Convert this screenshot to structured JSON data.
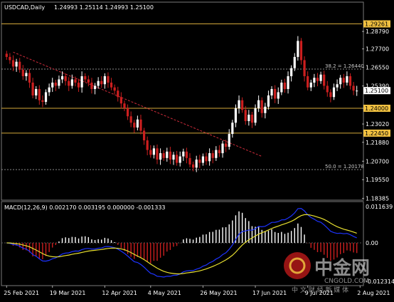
{
  "header": {
    "symbol": "USDCAD,Daily",
    "ohlc": "1.24993 1.25114 1.24993 1.25100"
  },
  "macd_label": "MACD(12,26,9) 0.002170 0.003195 0.000000 -0.001333",
  "levels": {
    "fib_382_label": "38.2 = 1.26440",
    "fib_50_label": "50.0 = 1.20178",
    "price_badges": [
      "1.29261",
      "1.25100",
      "1.24000",
      "1.22450"
    ]
  },
  "watermark": {
    "brand": "中金网",
    "url": "CNGOLD.COM",
    "tagline": "中 文 财 经 新 媒 体"
  },
  "colors": {
    "background": "#000000",
    "grid": "#4a4a4a",
    "bull_candle": "#ffffff",
    "bear_candle": "#cc1f1f",
    "hline": "#d4a83a",
    "trendline": "#cc2b3a",
    "macd_line": "#1d33ff",
    "signal_line": "#e8e030",
    "hist_pos": "#ffffff",
    "hist_neg": "#cc1f1f"
  },
  "chart_data": {
    "type": "candlestick",
    "symbol": "USDCAD",
    "timeframe": "Daily",
    "price_axis": {
      "ylim": [
        1.1885,
        1.2995
      ],
      "ticks": [
        "1.28790",
        "1.27700",
        "1.26550",
        "1.25390",
        "1.24000",
        "1.23020",
        "1.21880",
        "1.20700",
        "1.19550",
        "1.18385"
      ]
    },
    "x_ticks": [
      "25 Feb 2021",
      "19 Mar 2021",
      "12 Apr 2021",
      "4 May 2021",
      "26 May 2021",
      "17 Jun 2021",
      "9 Jul 2021",
      "2 Aug 2021"
    ],
    "x_tick_index": [
      0,
      14,
      30,
      44,
      60,
      76,
      92,
      108
    ],
    "horizontal_lines": [
      1.29261,
      1.24,
      1.2245
    ],
    "fib_levels": [
      {
        "label": "38.2",
        "value": 1.2644
      },
      {
        "label": "50.0",
        "value": 1.20178
      }
    ],
    "trendline": {
      "from": {
        "index": 2,
        "price": 1.275
      },
      "to": {
        "index": 78,
        "price": 1.21
      }
    },
    "closes": [
      1.272,
      1.27,
      1.266,
      1.269,
      1.264,
      1.26,
      1.262,
      1.256,
      1.248,
      1.252,
      1.245,
      1.244,
      1.25,
      1.253,
      1.256,
      1.254,
      1.258,
      1.26,
      1.257,
      1.254,
      1.258,
      1.256,
      1.253,
      1.26,
      1.258,
      1.256,
      1.252,
      1.254,
      1.257,
      1.255,
      1.26,
      1.256,
      1.253,
      1.251,
      1.247,
      1.243,
      1.24,
      1.235,
      1.231,
      1.228,
      1.233,
      1.226,
      1.22,
      1.214,
      1.211,
      1.215,
      1.208,
      1.212,
      1.209,
      1.213,
      1.208,
      1.211,
      1.206,
      1.21,
      1.213,
      1.209,
      1.205,
      1.203,
      1.208,
      1.206,
      1.21,
      1.207,
      1.212,
      1.209,
      1.214,
      1.212,
      1.218,
      1.216,
      1.224,
      1.231,
      1.24,
      1.245,
      1.239,
      1.232,
      1.236,
      1.231,
      1.24,
      1.245,
      1.237,
      1.241,
      1.248,
      1.252,
      1.246,
      1.25,
      1.256,
      1.252,
      1.26,
      1.265,
      1.272,
      1.282,
      1.27,
      1.26,
      1.253,
      1.256,
      1.259,
      1.257,
      1.261,
      1.254,
      1.25,
      1.247,
      1.253,
      1.255,
      1.259,
      1.256,
      1.26,
      1.254,
      1.251,
      1.251
    ],
    "macd": {
      "params": "12,26,9",
      "values": {
        "main": 0.00217,
        "signal": 0.003195,
        "third": 0.0,
        "fourth": -0.001333
      },
      "ylim": [
        -0.012314,
        0.011639
      ],
      "ticks": [
        "0.011639",
        "0.00",
        "-0.012314"
      ]
    }
  }
}
